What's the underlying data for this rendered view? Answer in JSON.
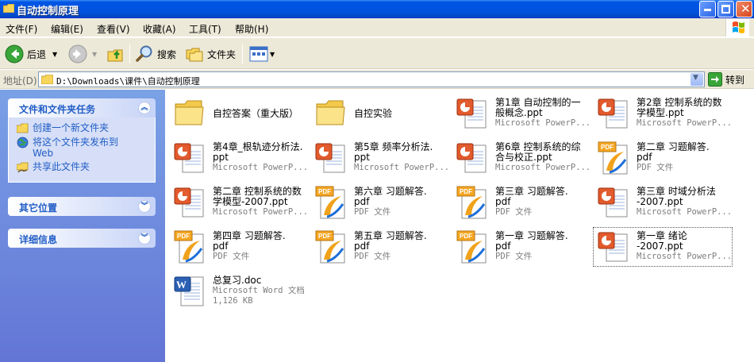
{
  "window": {
    "title": "自动控制原理"
  },
  "menu": [
    {
      "label": "文件(F)"
    },
    {
      "label": "编辑(E)"
    },
    {
      "label": "查看(V)"
    },
    {
      "label": "收藏(A)"
    },
    {
      "label": "工具(T)"
    },
    {
      "label": "帮助(H)"
    }
  ],
  "toolbar": {
    "back": "后退",
    "search": "搜索",
    "folders": "文件夹"
  },
  "address": {
    "label": "地址(D)",
    "path": "D:\\Downloads\\课件\\自动控制原理",
    "go": "转到"
  },
  "taskpane": {
    "tasks_title": "文件和文件夹任务",
    "tasks": [
      {
        "label": "创建一个新文件夹",
        "icon": "new-folder-icon"
      },
      {
        "label": "将这个文件夹发布到\nWeb",
        "icon": "publish-web-icon"
      },
      {
        "label": "共享此文件夹",
        "icon": "share-folder-icon"
      }
    ],
    "other_places": "其它位置",
    "details": "详细信息"
  },
  "files": [
    {
      "name": "自控答案（重大版）",
      "line2": "",
      "line3": "",
      "type": "folder"
    },
    {
      "name": "自控实验",
      "line2": "",
      "line3": "",
      "type": "folder"
    },
    {
      "name": "第1章 自动控制的一\n般概念.ppt",
      "line2": "Microsoft PowerP...",
      "line3": "",
      "type": "ppt"
    },
    {
      "name": "第2章  控制系统的数\n学模型.ppt",
      "line2": "Microsoft PowerP...",
      "line3": "",
      "type": "ppt"
    },
    {
      "name": "第4章_根轨迹分析法.\nppt",
      "line2": "Microsoft PowerP...",
      "line3": "",
      "type": "ppt"
    },
    {
      "name": "第5章 频率分析法.\nppt",
      "line2": "Microsoft PowerP...",
      "line3": "",
      "type": "ppt"
    },
    {
      "name": "第6章 控制系统的综\n合与校正.ppt",
      "line2": "Microsoft PowerP...",
      "line3": "",
      "type": "ppt"
    },
    {
      "name": "第二章  习题解答.\npdf",
      "line2": "PDF 文件",
      "line3": "",
      "type": "pdf"
    },
    {
      "name": "第二章 控制系统的数\n学模型-2007.ppt",
      "line2": "Microsoft PowerP...",
      "line3": "",
      "type": "ppt"
    },
    {
      "name": "第六章  习题解答.\npdf",
      "line2": "PDF 文件",
      "line3": "",
      "type": "pdf"
    },
    {
      "name": "第三章  习题解答.\npdf",
      "line2": "PDF 文件",
      "line3": "",
      "type": "pdf"
    },
    {
      "name": "第三章 时域分析法\n-2007.ppt",
      "line2": "Microsoft PowerP...",
      "line3": "",
      "type": "ppt"
    },
    {
      "name": "第四章  习题解答.\npdf",
      "line2": "PDF 文件",
      "line3": "",
      "type": "pdf"
    },
    {
      "name": "第五章  习题解答.\npdf",
      "line2": "PDF 文件",
      "line3": "",
      "type": "pdf"
    },
    {
      "name": "第一章  习题解答.\npdf",
      "line2": "PDF 文件",
      "line3": "",
      "type": "pdf"
    },
    {
      "name": "第一章  绪论\n-2007.ppt",
      "line2": "Microsoft PowerP...",
      "line3": "",
      "type": "ppt",
      "selected": true
    },
    {
      "name": "总复习.doc",
      "line2": "Microsoft Word 文档",
      "line3": "1,126 KB",
      "type": "doc"
    }
  ],
  "colors": {
    "titlebar": "#0054e3",
    "taskpane": "#7aa1e6",
    "link": "#215dc6"
  }
}
